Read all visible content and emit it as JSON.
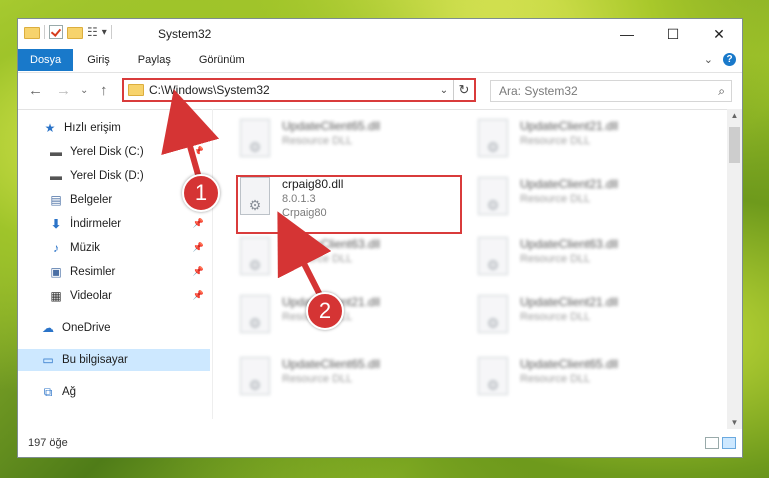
{
  "window": {
    "title": "System32",
    "controls": [
      "—",
      "☐",
      "✕"
    ],
    "qat_dropdown": "▾"
  },
  "ribbon": {
    "tabs": [
      "Dosya",
      "Giriş",
      "Paylaş",
      "Görünüm"
    ],
    "expand": "⌄",
    "help": "?"
  },
  "address": {
    "path": "C:\\Windows\\System32",
    "dropdown": "⌄",
    "refresh": "↻"
  },
  "search": {
    "placeholder": "Ara: System32",
    "icon": "⌕"
  },
  "nav_buttons": {
    "back": "←",
    "forward": "→",
    "down": "⌄",
    "up": "↑"
  },
  "sidebar": {
    "items": [
      {
        "label": "Hızlı erişim",
        "icon": "star-icon"
      },
      {
        "label": "Yerel Disk (C:)",
        "icon": "drive-icon",
        "pinned": true
      },
      {
        "label": "Yerel Disk (D:)",
        "icon": "drive-icon"
      },
      {
        "label": "Belgeler",
        "icon": "documents-icon",
        "pinned": true
      },
      {
        "label": "İndirmeler",
        "icon": "download-icon",
        "pinned": true
      },
      {
        "label": "Müzik",
        "icon": "music-icon",
        "pinned": true
      },
      {
        "label": "Resimler",
        "icon": "pictures-icon",
        "pinned": true
      },
      {
        "label": "Videolar",
        "icon": "video-icon",
        "pinned": true
      },
      {
        "label": "OneDrive",
        "icon": "cloud-icon"
      },
      {
        "label": "Bu bilgisayar",
        "icon": "computer-icon",
        "selected": true
      },
      {
        "label": "Ağ",
        "icon": "network-icon"
      }
    ]
  },
  "files": {
    "highlighted": {
      "name": "crpaig80.dll",
      "version": "8.0.1.3",
      "description": "Crpaig80"
    },
    "blurred": [
      {
        "name": "UpdateClient65.dll",
        "type": "Resource DLL"
      },
      {
        "name": "UpdateClient21.dll",
        "type": "Resource DLL"
      },
      {
        "name": "UpdateClient21.dll",
        "type": "Resource DLL"
      },
      {
        "name": "UpdateClient63.dll",
        "type": "Resource DLL"
      },
      {
        "name": "UpdateClient63.dll",
        "type": "Resource DLL"
      },
      {
        "name": "UpdateClient21.dll",
        "type": "Resource DLL"
      },
      {
        "name": "UpdateClient21.dll",
        "type": "Resource DLL"
      },
      {
        "name": "UpdateClient65.dll",
        "type": "Resource DLL"
      },
      {
        "name": "UpdateClient65.dll",
        "type": "Resource DLL"
      }
    ]
  },
  "status": {
    "count": "197 öğe"
  },
  "callouts": [
    "1",
    "2"
  ],
  "colors": {
    "accent": "#1979ca",
    "highlight": "#d93b3b",
    "selection": "#cde8ff"
  }
}
